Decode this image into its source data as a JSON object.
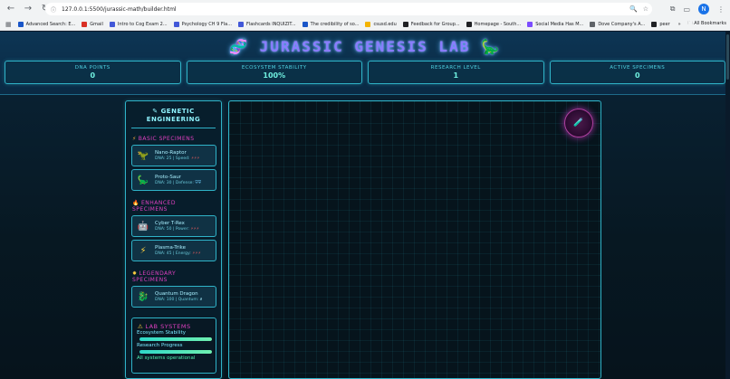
{
  "browser": {
    "url": "127.0.0.1:5500/jurassic-math/builder.html",
    "nav": {
      "back": "←",
      "forward": "→",
      "reload": "↻"
    },
    "bookmarks": [
      {
        "label": "Advanced Search: E...",
        "color": "#1a56c8"
      },
      {
        "label": "Gmail",
        "color": "#d93025"
      },
      {
        "label": "Intro to Cog Exam 2...",
        "color": "#4258d8"
      },
      {
        "label": "Psychology CH 9 Fla...",
        "color": "#4258d8"
      },
      {
        "label": "Flashcards INQUIZIT...",
        "color": "#4258d8"
      },
      {
        "label": "The credibility of so...",
        "color": "#1a56c8"
      },
      {
        "label": "csusd.edu",
        "color": "#f4b400"
      },
      {
        "label": "Feedback for Group...",
        "color": "#202124"
      },
      {
        "label": "Homepage - South...",
        "color": "#202124"
      },
      {
        "label": "Social Media Has M...",
        "color": "#7c4dff"
      },
      {
        "label": "Dove Company's A...",
        "color": "#5f6368"
      },
      {
        "label": "peer",
        "color": "#202124"
      }
    ],
    "all_bookmarks": "All Bookmarks",
    "profile_initial": "N"
  },
  "app": {
    "title": "JURASSIC GENESIS LAB",
    "title_icon_left": "🧬",
    "title_icon_right": "🦕",
    "stats": [
      {
        "label": "DNA POINTS",
        "value": "0"
      },
      {
        "label": "ECOSYSTEM STABILITY",
        "value": "100%"
      },
      {
        "label": "RESEARCH LEVEL",
        "value": "1"
      },
      {
        "label": "ACTIVE SPECIMENS",
        "value": "0"
      }
    ],
    "sidebar": {
      "title_line1": "GENETIC",
      "title_line2": "ENGINEERING",
      "title_icon": "✎",
      "sections": [
        {
          "title": "BASIC SPECIMENS",
          "icon": "⚡",
          "items": [
            {
              "name": "Nano-Raptor",
              "info": "DNA: 25 | Speed:",
              "tags": "⚡⚡⚡",
              "icon": "🦖"
            },
            {
              "name": "Proto-Saur",
              "info": "DNA: 30 | Defense:",
              "tags": "⛨⛨",
              "icon": "🦕"
            }
          ]
        },
        {
          "title_line1": "ENHANCED",
          "title_line2": "SPECIMENS",
          "icon": "🔥",
          "items": [
            {
              "name": "Cyber T-Rex",
              "info": "DNA: 50 | Power:",
              "tags": "⚡⚡⚡",
              "icon": "🤖"
            },
            {
              "name": "Plasma-Trike",
              "info": "DNA: 45 | Energy:",
              "tags": "⚡⚡⚡",
              "icon": "⚡"
            }
          ]
        },
        {
          "title_line1": "LEGENDARY",
          "title_line2": "SPECIMENS",
          "icon": "✸",
          "items": [
            {
              "name": "Quantum Dragon",
              "info": "DNA: 100 | Quantum:",
              "tags": "∂",
              "icon": "🐉"
            }
          ]
        }
      ]
    },
    "lab_systems": {
      "title": "LAB SYSTEMS",
      "icon": "⚠",
      "ecosystem_label": "Ecosystem Stability",
      "ecosystem_value": 1.0,
      "research_label": "Research Progress",
      "research_value": 1.0,
      "status": "All systems operational"
    },
    "canvas_orb_icon": "🧪"
  }
}
